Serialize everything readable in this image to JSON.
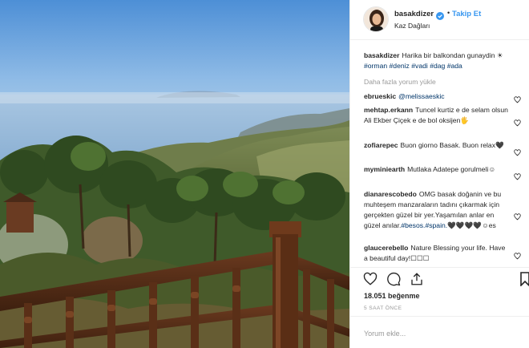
{
  "post": {
    "image_alt": "Balcony view over pine forest and sea",
    "image_icon": "landscape-photo"
  },
  "header": {
    "username": "basakdizer",
    "separator": "•",
    "follow_label": "Takip Et",
    "location": "Kaz Dağları",
    "verified_icon": "verified-badge-icon"
  },
  "caption": {
    "username": "basakdizer",
    "text": "Harika bir balkondan gunaydin ☀",
    "tags": [
      "#orman",
      "#deniz",
      "#vadi",
      "#dag",
      "#ada"
    ]
  },
  "load_more_label": "Daha fazla yorum yükle",
  "comments": [
    {
      "username": "ebrueskic",
      "text": "@melissaeskic",
      "mention": true
    },
    {
      "username": "mehtap.erkann",
      "text": "Tuncel kurtiz e de selam olsun Ali Ekber Çiçek e de bol oksijen🖐"
    },
    {
      "username": "zofiarepec",
      "text": "Buon giorno Basak. Buon relax🖤"
    },
    {
      "username": "myminiearth",
      "text": "Mutlaka Adatepe gorulmeli☺"
    },
    {
      "username": "dianarescobedo",
      "text": "OMG basak doğanin ve bu muhteşem manzaraların tadını çıkarmak için gerçekten güzel bir yer.Yaşamılan anlar en güzel anılar.",
      "tags": [
        "#besos.",
        "#spain."
      ],
      "suffix": "🖤🖤🖤🖤☺es"
    },
    {
      "username": "glaucerebello",
      "text": "Nature Blessing your life. Have a beautiful day!☐☐☐"
    }
  ],
  "actions": {
    "like_icon": "heart-icon",
    "comment_icon": "comment-icon",
    "share_icon": "share-icon",
    "save_icon": "bookmark-icon"
  },
  "likes_label": "18.051 beğenme",
  "time_label": "5 SAAT ÖNCE",
  "add_comment_placeholder": "Yorum ekle...",
  "colors": {
    "link_blue": "#3897f0",
    "hashtag": "#003569",
    "muted": "#999999",
    "border": "#efefef"
  }
}
